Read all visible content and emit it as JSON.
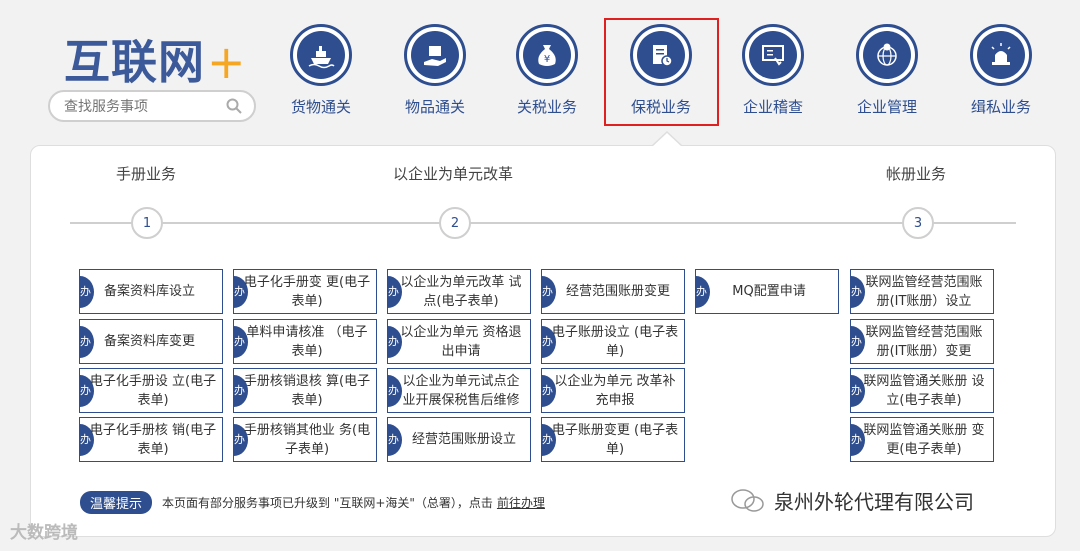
{
  "logo": {
    "text": "互联网",
    "plus": "+"
  },
  "search": {
    "placeholder": "查找服务事项"
  },
  "nav": [
    {
      "label": "货物通关",
      "icon": "ship-icon"
    },
    {
      "label": "物品通关",
      "icon": "package-hand-icon"
    },
    {
      "label": "关税业务",
      "icon": "yen-bag-icon"
    },
    {
      "label": "保税业务",
      "icon": "clipboard-clock-icon"
    },
    {
      "label": "企业稽查",
      "icon": "inspect-screen-icon"
    },
    {
      "label": "企业管理",
      "icon": "globe-pin-icon"
    },
    {
      "label": "缉私业务",
      "icon": "siren-icon"
    }
  ],
  "steps": [
    {
      "title": "手册业务",
      "num": "1"
    },
    {
      "title": "以企业为单元改革",
      "num": "2"
    },
    {
      "title": "帐册业务",
      "num": "3"
    }
  ],
  "card_tag": "办",
  "cards": [
    [
      "备案资料库设立",
      "备案资料库变更",
      "电子化手册设 立(电子表单)",
      "电子化手册核 销(电子表单)"
    ],
    [
      "电子化手册变 更(电子表单)",
      "单料申请核准 （电子表单)",
      "手册核销退核 算(电子表单)",
      "手册核销其他业 务(电子表单)"
    ],
    [
      "以企业为单元改革 试点(电子表单)",
      "以企业为单元 资格退出申请",
      "以企业为单元试点企 业开展保税售后维修",
      "经营范围账册设立"
    ],
    [
      "经营范围账册变更",
      "电子账册设立 (电子表单)",
      "以企业为单元 改革补充申报",
      "电子账册变更 (电子表单)"
    ],
    [
      "MQ配置申请"
    ],
    [
      "联网监管经营范围账 册(IT账册）设立",
      "联网监管经营范围账 册(IT账册）变更",
      "联网监管通关账册 设立(电子表单)",
      "联网监管通关账册 变更(电子表单)"
    ]
  ],
  "notice": {
    "badge": "温馨提示",
    "text": "本页面有部分服务事项已升级到 \"互联网+海关\"（总署），点击",
    "link": "前往办理"
  },
  "watermarks": {
    "company": "泉州外轮代理有限公司",
    "brand": "大数跨境"
  },
  "colors": {
    "primary": "#2e4e8f",
    "accent": "#f5a623",
    "highlight": "#e02020"
  }
}
